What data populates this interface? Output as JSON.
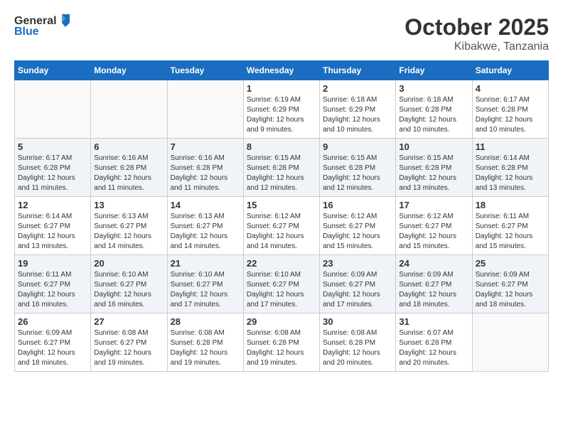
{
  "logo": {
    "general": "General",
    "blue": "Blue"
  },
  "header": {
    "month": "October 2025",
    "location": "Kibakwe, Tanzania"
  },
  "weekdays": [
    "Sunday",
    "Monday",
    "Tuesday",
    "Wednesday",
    "Thursday",
    "Friday",
    "Saturday"
  ],
  "weeks": [
    [
      {
        "day": "",
        "info": ""
      },
      {
        "day": "",
        "info": ""
      },
      {
        "day": "",
        "info": ""
      },
      {
        "day": "1",
        "info": "Sunrise: 6:19 AM\nSunset: 6:29 PM\nDaylight: 12 hours\nand 9 minutes."
      },
      {
        "day": "2",
        "info": "Sunrise: 6:18 AM\nSunset: 6:29 PM\nDaylight: 12 hours\nand 10 minutes."
      },
      {
        "day": "3",
        "info": "Sunrise: 6:18 AM\nSunset: 6:28 PM\nDaylight: 12 hours\nand 10 minutes."
      },
      {
        "day": "4",
        "info": "Sunrise: 6:17 AM\nSunset: 6:28 PM\nDaylight: 12 hours\nand 10 minutes."
      }
    ],
    [
      {
        "day": "5",
        "info": "Sunrise: 6:17 AM\nSunset: 6:28 PM\nDaylight: 12 hours\nand 11 minutes."
      },
      {
        "day": "6",
        "info": "Sunrise: 6:16 AM\nSunset: 6:28 PM\nDaylight: 12 hours\nand 11 minutes."
      },
      {
        "day": "7",
        "info": "Sunrise: 6:16 AM\nSunset: 6:28 PM\nDaylight: 12 hours\nand 11 minutes."
      },
      {
        "day": "8",
        "info": "Sunrise: 6:15 AM\nSunset: 6:28 PM\nDaylight: 12 hours\nand 12 minutes."
      },
      {
        "day": "9",
        "info": "Sunrise: 6:15 AM\nSunset: 6:28 PM\nDaylight: 12 hours\nand 12 minutes."
      },
      {
        "day": "10",
        "info": "Sunrise: 6:15 AM\nSunset: 6:28 PM\nDaylight: 12 hours\nand 13 minutes."
      },
      {
        "day": "11",
        "info": "Sunrise: 6:14 AM\nSunset: 6:28 PM\nDaylight: 12 hours\nand 13 minutes."
      }
    ],
    [
      {
        "day": "12",
        "info": "Sunrise: 6:14 AM\nSunset: 6:27 PM\nDaylight: 12 hours\nand 13 minutes."
      },
      {
        "day": "13",
        "info": "Sunrise: 6:13 AM\nSunset: 6:27 PM\nDaylight: 12 hours\nand 14 minutes."
      },
      {
        "day": "14",
        "info": "Sunrise: 6:13 AM\nSunset: 6:27 PM\nDaylight: 12 hours\nand 14 minutes."
      },
      {
        "day": "15",
        "info": "Sunrise: 6:12 AM\nSunset: 6:27 PM\nDaylight: 12 hours\nand 14 minutes."
      },
      {
        "day": "16",
        "info": "Sunrise: 6:12 AM\nSunset: 6:27 PM\nDaylight: 12 hours\nand 15 minutes."
      },
      {
        "day": "17",
        "info": "Sunrise: 6:12 AM\nSunset: 6:27 PM\nDaylight: 12 hours\nand 15 minutes."
      },
      {
        "day": "18",
        "info": "Sunrise: 6:11 AM\nSunset: 6:27 PM\nDaylight: 12 hours\nand 15 minutes."
      }
    ],
    [
      {
        "day": "19",
        "info": "Sunrise: 6:11 AM\nSunset: 6:27 PM\nDaylight: 12 hours\nand 16 minutes."
      },
      {
        "day": "20",
        "info": "Sunrise: 6:10 AM\nSunset: 6:27 PM\nDaylight: 12 hours\nand 16 minutes."
      },
      {
        "day": "21",
        "info": "Sunrise: 6:10 AM\nSunset: 6:27 PM\nDaylight: 12 hours\nand 17 minutes."
      },
      {
        "day": "22",
        "info": "Sunrise: 6:10 AM\nSunset: 6:27 PM\nDaylight: 12 hours\nand 17 minutes."
      },
      {
        "day": "23",
        "info": "Sunrise: 6:09 AM\nSunset: 6:27 PM\nDaylight: 12 hours\nand 17 minutes."
      },
      {
        "day": "24",
        "info": "Sunrise: 6:09 AM\nSunset: 6:27 PM\nDaylight: 12 hours\nand 18 minutes."
      },
      {
        "day": "25",
        "info": "Sunrise: 6:09 AM\nSunset: 6:27 PM\nDaylight: 12 hours\nand 18 minutes."
      }
    ],
    [
      {
        "day": "26",
        "info": "Sunrise: 6:09 AM\nSunset: 6:27 PM\nDaylight: 12 hours\nand 18 minutes."
      },
      {
        "day": "27",
        "info": "Sunrise: 6:08 AM\nSunset: 6:27 PM\nDaylight: 12 hours\nand 19 minutes."
      },
      {
        "day": "28",
        "info": "Sunrise: 6:08 AM\nSunset: 6:28 PM\nDaylight: 12 hours\nand 19 minutes."
      },
      {
        "day": "29",
        "info": "Sunrise: 6:08 AM\nSunset: 6:28 PM\nDaylight: 12 hours\nand 19 minutes."
      },
      {
        "day": "30",
        "info": "Sunrise: 6:08 AM\nSunset: 6:28 PM\nDaylight: 12 hours\nand 20 minutes."
      },
      {
        "day": "31",
        "info": "Sunrise: 6:07 AM\nSunset: 6:28 PM\nDaylight: 12 hours\nand 20 minutes."
      },
      {
        "day": "",
        "info": ""
      }
    ]
  ]
}
